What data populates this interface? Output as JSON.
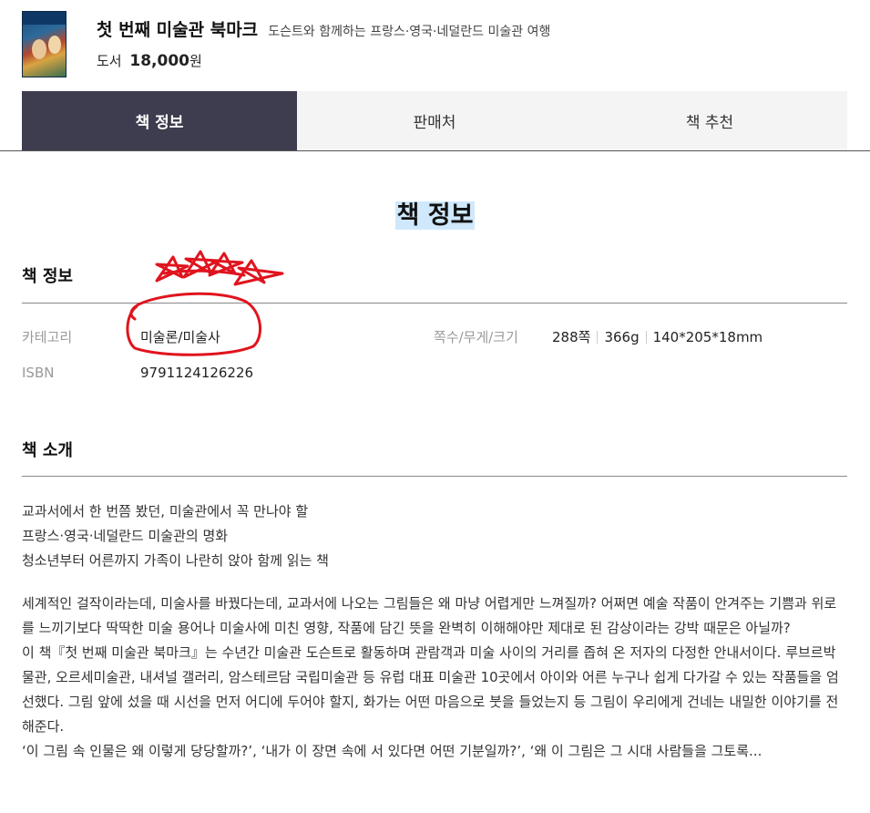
{
  "book": {
    "title": "첫 번째 미술관 북마크",
    "subtitle": "도슨트와 함께하는 프랑스·영국·네덜란드 미술관 여행",
    "price_prefix": "도서",
    "price": "18,000",
    "price_unit": "원"
  },
  "tabs": [
    {
      "label": "책 정보",
      "active": true
    },
    {
      "label": "판매처",
      "active": false
    },
    {
      "label": "책 추천",
      "active": false
    }
  ],
  "section_heading": "책 정보",
  "info": {
    "heading": "책 정보",
    "category_label": "카테고리",
    "category_value": "미술론/미술사",
    "isbn_label": "ISBN",
    "isbn_value": "9791124126226",
    "specs_label": "쪽수/무게/크기",
    "pages": "288쪽",
    "weight": "366g",
    "size": "140*205*18mm"
  },
  "intro": {
    "heading": "책 소개",
    "lead_lines": [
      "교과서에서 한 번쯤 봤던, 미술관에서 꼭 만나야 할",
      "프랑스·영국·네덜란드 미술관의 명화",
      "청소년부터 어른까지 가족이 나란히 앉아 함께 읽는 책"
    ],
    "paragraph1": "세계적인 걸작이라는데, 미술사를 바꿨다는데, 교과서에 나오는 그림들은 왜 마냥 어렵게만 느껴질까? 어쩌면 예술 작품이 안겨주는 기쁨과 위로를 느끼기보다 딱딱한 미술 용어나 미술사에 미친 영향, 작품에 담긴 뜻을 완벽히 이해해야만 제대로 된 감상이라는 강박 때문은 아닐까?",
    "paragraph2": "이 책『첫 번째 미술관 북마크』는 수년간 미술관 도슨트로 활동하며 관람객과 미술 사이의 거리를 좁혀 온 저자의 다정한 안내서이다. 루브르박물관, 오르세미술관, 내셔널 갤러리, 암스테르담 국립미술관 등 유럽 대표 미술관 10곳에서 아이와 어른 누구나 쉽게 다가갈 수 있는 작품들을 엄선했다. 그림 앞에 섰을 때 시선을 먼저 어디에 두어야 할지, 화가는 어떤 마음으로 붓을 들었는지 등 그림이 우리에게 건네는 내밀한 이야기를 전해준다.",
    "paragraph3": "‘이 그림 속 인물은 왜 이렇게 당당할까?’, ‘내가 이 장면 속에 서 있다면 어떤 기분일까?’, ‘왜 이 그림은 그 시대 사람들을 그토록..."
  },
  "colors": {
    "active_tab_bg": "#3e3d4f",
    "tab_bg": "#f4f4f4",
    "heading_highlight": "#cfe8fb",
    "annotation_red": "#e0141e"
  }
}
